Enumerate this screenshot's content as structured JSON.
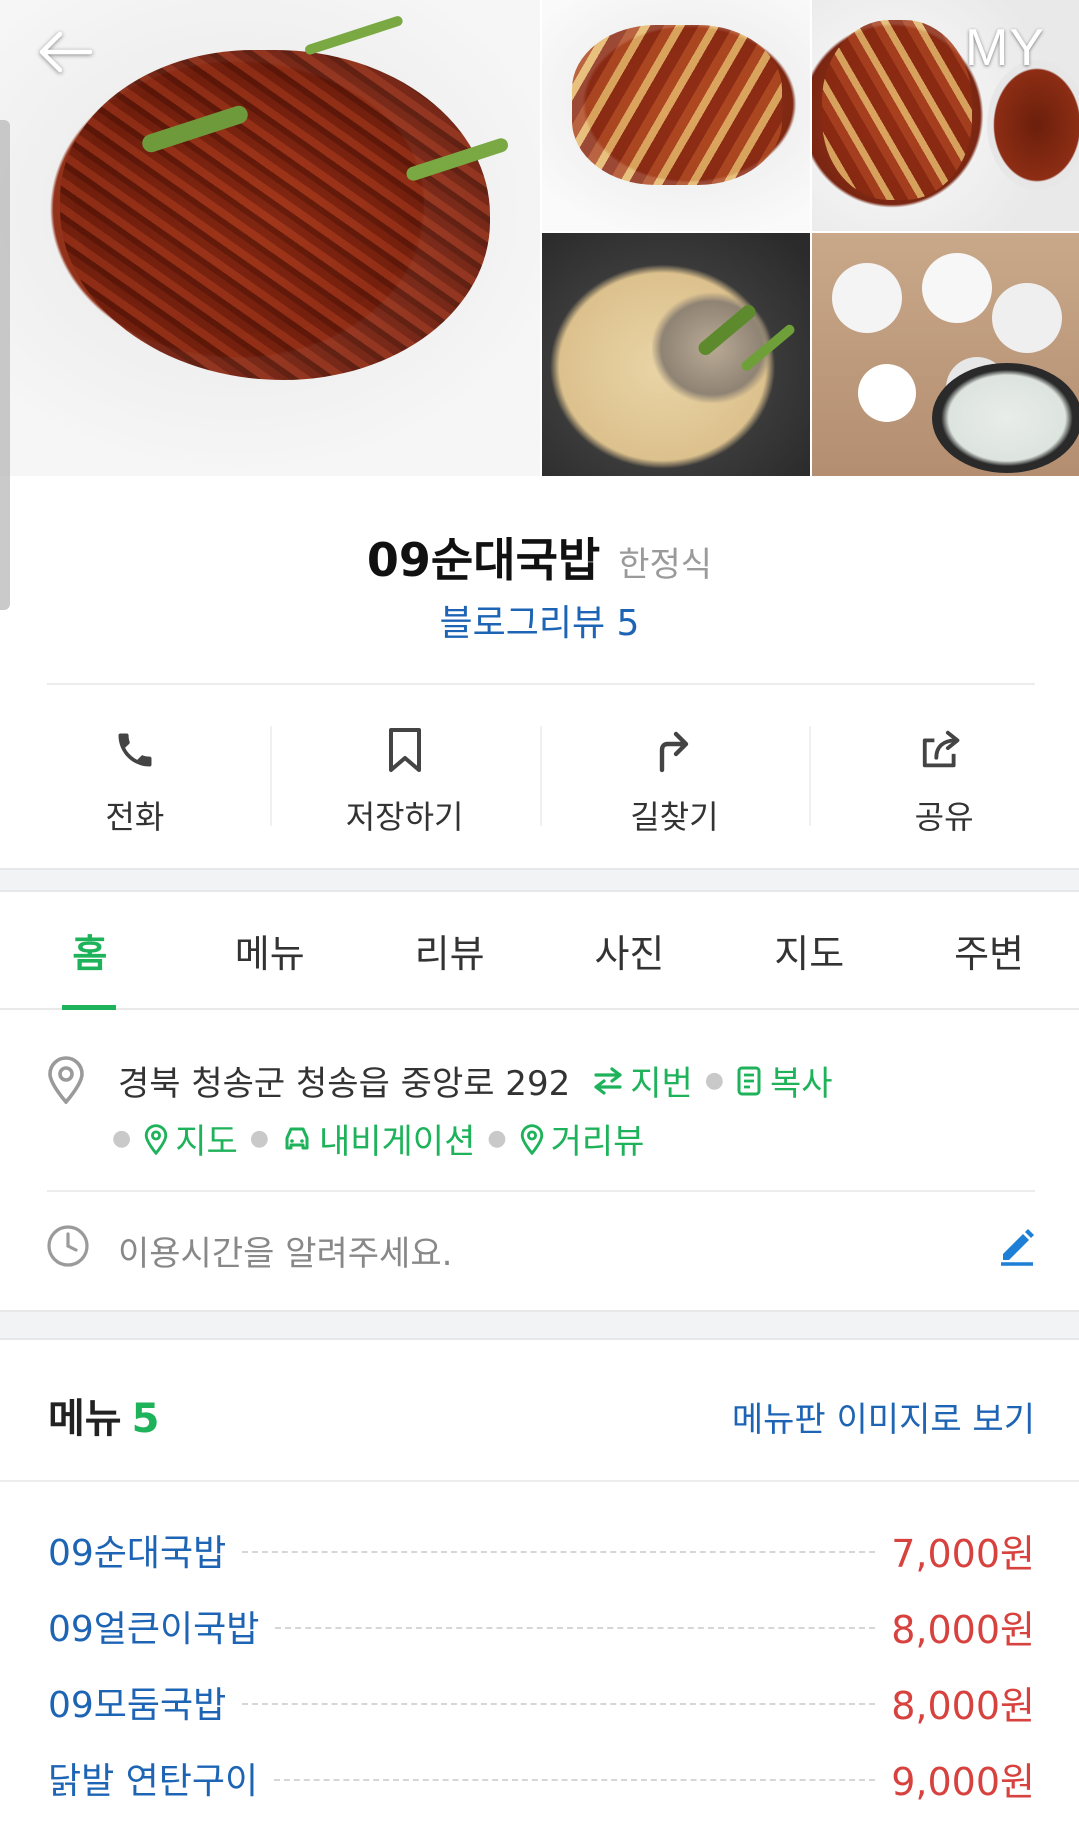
{
  "header": {
    "back_icon": "arrow-left-icon",
    "my_label": "MY"
  },
  "place": {
    "name": "09순대국밥",
    "category": "한정식",
    "blog_review": "블로그리뷰 5"
  },
  "actions": [
    {
      "label": "전화",
      "icon": "phone-icon"
    },
    {
      "label": "저장하기",
      "icon": "bookmark-icon"
    },
    {
      "label": "길찾기",
      "icon": "directions-icon"
    },
    {
      "label": "공유",
      "icon": "share-icon"
    }
  ],
  "tabs": [
    {
      "label": "홈",
      "active": true
    },
    {
      "label": "메뉴",
      "active": false
    },
    {
      "label": "리뷰",
      "active": false
    },
    {
      "label": "사진",
      "active": false
    },
    {
      "label": "지도",
      "active": false
    },
    {
      "label": "주변",
      "active": false
    }
  ],
  "address": {
    "text": "경북 청송군 청송읍 중앙로 292",
    "jibun": "지번",
    "copy": "복사",
    "map": "지도",
    "navigation": "내비게이션",
    "street_view": "거리뷰"
  },
  "hours": {
    "prompt": "이용시간을 알려주세요."
  },
  "menu": {
    "title": "메뉴",
    "count": "5",
    "image_link": "메뉴판 이미지로 보기",
    "items": [
      {
        "name": "09순대국밥",
        "price": "7,000원"
      },
      {
        "name": "09얼큰이국밥",
        "price": "8,000원"
      },
      {
        "name": "09모둠국밥",
        "price": "8,000원"
      },
      {
        "name": "닭발 연탄구이",
        "price": "9,000원"
      }
    ]
  },
  "colors": {
    "accent_green": "#1eb25a",
    "link_blue": "#1e64b4",
    "price_red": "#d7423f"
  }
}
